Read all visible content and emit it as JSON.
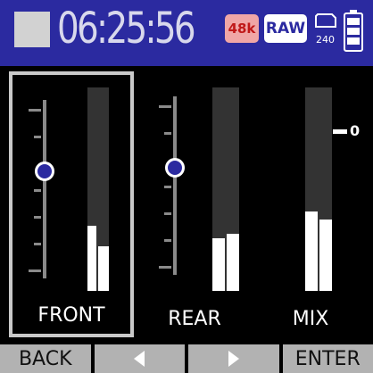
{
  "status": {
    "stop_icon": "stop-square-icon",
    "time": "06:25:56",
    "sample_rate": "48k",
    "format": "RAW",
    "card_label": "240"
  },
  "channels": [
    {
      "label": "FRONT",
      "selected": true,
      "fader_level": 0.6,
      "meter": [
        0.32,
        0.22
      ]
    },
    {
      "label": "REAR",
      "selected": false,
      "fader_level": 0.6,
      "meter": [
        0.26,
        0.28
      ]
    },
    {
      "label": "MIX",
      "selected": false,
      "meter": [
        0.39,
        0.35
      ]
    }
  ],
  "mix_scale_label": "0",
  "softkeys": {
    "back": "BACK",
    "left_icon": "arrow-left-icon",
    "right_icon": "arrow-right-icon",
    "enter": "ENTER"
  },
  "colors": {
    "accent": "#2b2aa0",
    "rate_badge": "#f0a6a6",
    "meter_fill": "#ffffff"
  }
}
